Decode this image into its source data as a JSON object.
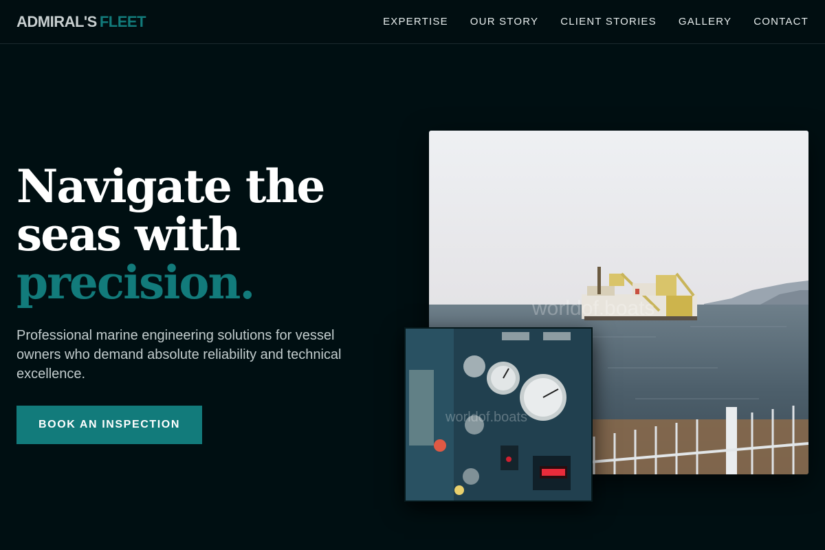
{
  "header": {
    "logo_primary": "ADMIRAL'S",
    "logo_secondary": "FLEET",
    "nav": [
      {
        "label": "EXPERTISE"
      },
      {
        "label": "OUR STORY"
      },
      {
        "label": "CLIENT STORIES"
      },
      {
        "label": "GALLERY"
      },
      {
        "label": "CONTACT"
      }
    ]
  },
  "hero": {
    "title_line1": "Navigate the",
    "title_line2": "seas with",
    "title_accent": "precision.",
    "subtitle": "Professional marine engineering solutions for vessel owners who demand absolute reliability and technical excellence.",
    "cta_label": "BOOK AN INSPECTION"
  },
  "images": {
    "main_watermark": "worldof.boats",
    "inset_watermark": "worldof.boats"
  },
  "colors": {
    "background": "#000f12",
    "accent": "#127b7b",
    "text": "#ffffff",
    "muted_text": "#c3cdce"
  }
}
